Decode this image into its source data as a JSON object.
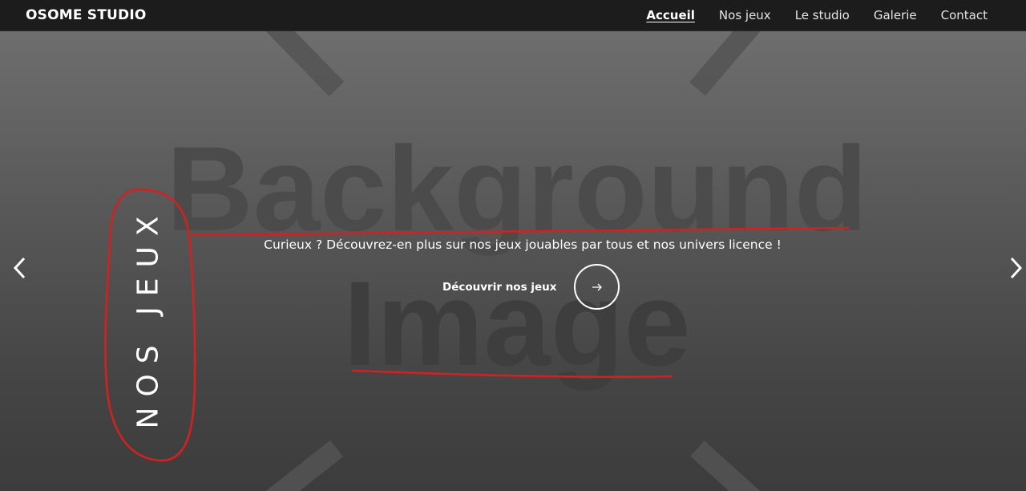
{
  "nav": {
    "brand": "OSOME STUDIO",
    "links": [
      "Accueil",
      "Nos jeux",
      "Le studio",
      "Galerie",
      "Contact"
    ],
    "active": "Accueil"
  },
  "hero": {
    "placeholder_line1": "Background",
    "placeholder_line2": "Image",
    "title": "NOS JEUX",
    "subtitle": "Curieux ? Découvrez-en plus sur nos jeux jouables par tous et nos univers licence !",
    "cta_label": "Découvrir nos jeux",
    "cta_icon": "arrow-right-icon",
    "prev_icon": "chevron-left-icon",
    "next_icon": "chevron-right-icon"
  },
  "colors": {
    "navbar": "#1c1c1c",
    "annotation": "#d42020",
    "text": "#ffffff"
  }
}
